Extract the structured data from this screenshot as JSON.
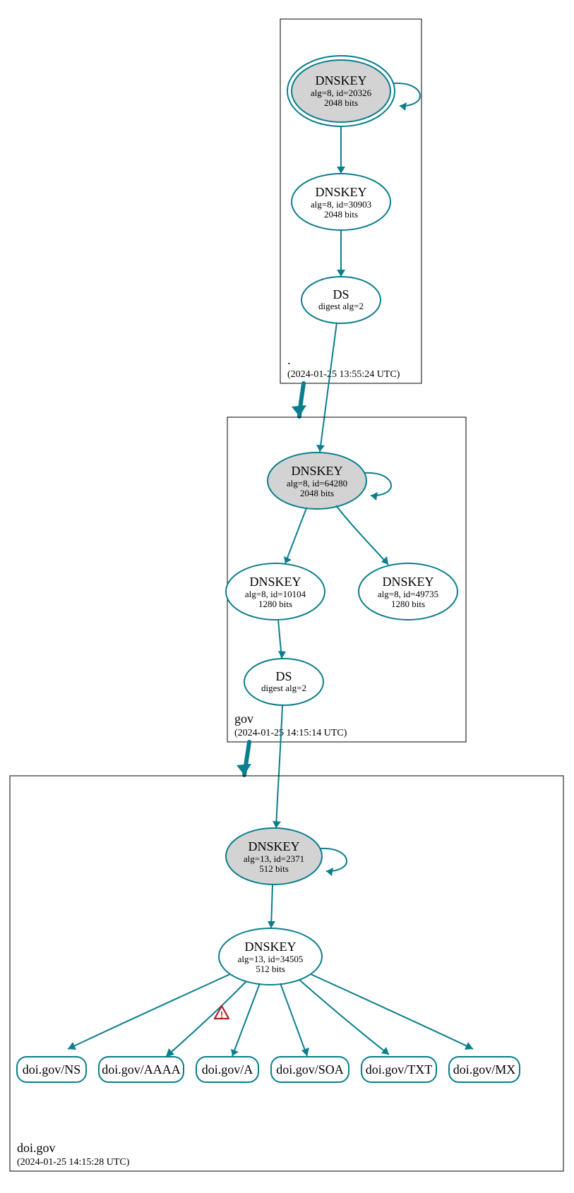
{
  "zones": {
    "root": {
      "label": ".",
      "timestamp": "(2024-01-25 13:55:24 UTC)"
    },
    "gov": {
      "label": "gov",
      "timestamp": "(2024-01-25 14:15:14 UTC)"
    },
    "doigov": {
      "label": "doi.gov",
      "timestamp": "(2024-01-25 14:15:28 UTC)"
    }
  },
  "nodes": {
    "root_ksk": {
      "title": "DNSKEY",
      "line1": "alg=8, id=20326",
      "line2": "2048 bits"
    },
    "root_zsk": {
      "title": "DNSKEY",
      "line1": "alg=8, id=30903",
      "line2": "2048 bits"
    },
    "root_ds": {
      "title": "DS",
      "line1": "digest alg=2",
      "line2": ""
    },
    "gov_ksk": {
      "title": "DNSKEY",
      "line1": "alg=8, id=64280",
      "line2": "2048 bits"
    },
    "gov_zsk_a": {
      "title": "DNSKEY",
      "line1": "alg=8, id=10104",
      "line2": "1280 bits"
    },
    "gov_zsk_b": {
      "title": "DNSKEY",
      "line1": "alg=8, id=49735",
      "line2": "1280 bits"
    },
    "gov_ds": {
      "title": "DS",
      "line1": "digest alg=2",
      "line2": ""
    },
    "doi_ksk": {
      "title": "DNSKEY",
      "line1": "alg=13, id=2371",
      "line2": "512 bits"
    },
    "doi_zsk": {
      "title": "DNSKEY",
      "line1": "alg=13, id=34505",
      "line2": "512 bits"
    }
  },
  "records": {
    "ns": "doi.gov/NS",
    "aaaa": "doi.gov/AAAA",
    "a": "doi.gov/A",
    "soa": "doi.gov/SOA",
    "txt": "doi.gov/TXT",
    "mx": "doi.gov/MX"
  },
  "colors": {
    "stroke": "#0a7e8c",
    "fill_grey": "#d3d3d3",
    "warn": "#b22222"
  }
}
